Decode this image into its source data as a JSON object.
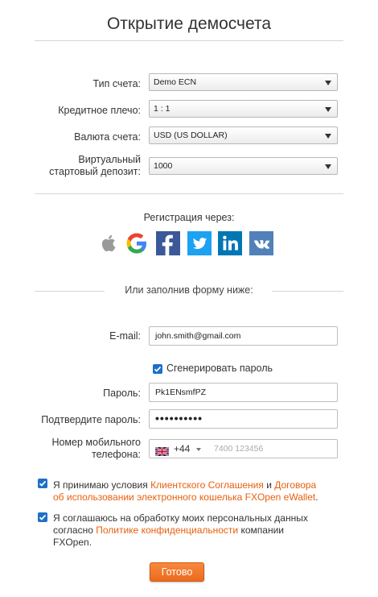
{
  "title": "Открытие демосчета",
  "account": {
    "type_label": "Тип счета:",
    "type_value": "Demo ECN",
    "leverage_label": "Кредитное плечо:",
    "leverage_value": "1 : 1",
    "currency_label": "Валюта счета:",
    "currency_value": "USD (US DOLLAR)",
    "deposit_label_1": "Виртуальный",
    "deposit_label_2": "стартовый депозит:",
    "deposit_value": "1000"
  },
  "registration": {
    "label": "Регистрация через:",
    "providers": [
      "apple-icon",
      "google-icon",
      "facebook-icon",
      "twitter-icon",
      "linkedin-icon",
      "vk-icon"
    ]
  },
  "form": {
    "or_text": "Или заполнив форму ниже:",
    "email_label": "E-mail:",
    "email_value": "john.smith@gmail.com",
    "generate_password_label": "Сгенерировать пароль",
    "password_label": "Пароль:",
    "password_value": "Pk1ENsmfPZ",
    "confirm_label": "Подтвердите пароль:",
    "confirm_value": "••••••••••",
    "phone_label_1": "Номер мобильного",
    "phone_label_2": "телефона:",
    "phone_code": "+44",
    "phone_placeholder": "7400 123456"
  },
  "agreements": {
    "terms_prefix": "Я принимаю условия ",
    "terms_link1": "Клиентского Соглашения",
    "terms_and": " и ",
    "terms_link2_line1": "Договора",
    "terms_link2_line2": "об использовании электронного кошелька FXOpen eWallet",
    "terms_suffix": ".",
    "privacy_line1": "Я соглашаюсь на обработку моих персональных данных",
    "privacy_prefix2": "согласно ",
    "privacy_link": "Политике конфиденциальности",
    "privacy_suffix2": " компании",
    "privacy_line3": "FXOpen."
  },
  "submit_label": "Готово",
  "colors": {
    "accent": "#ec6a1c",
    "link": "#e8600e",
    "checkbox": "#1e70c8"
  }
}
